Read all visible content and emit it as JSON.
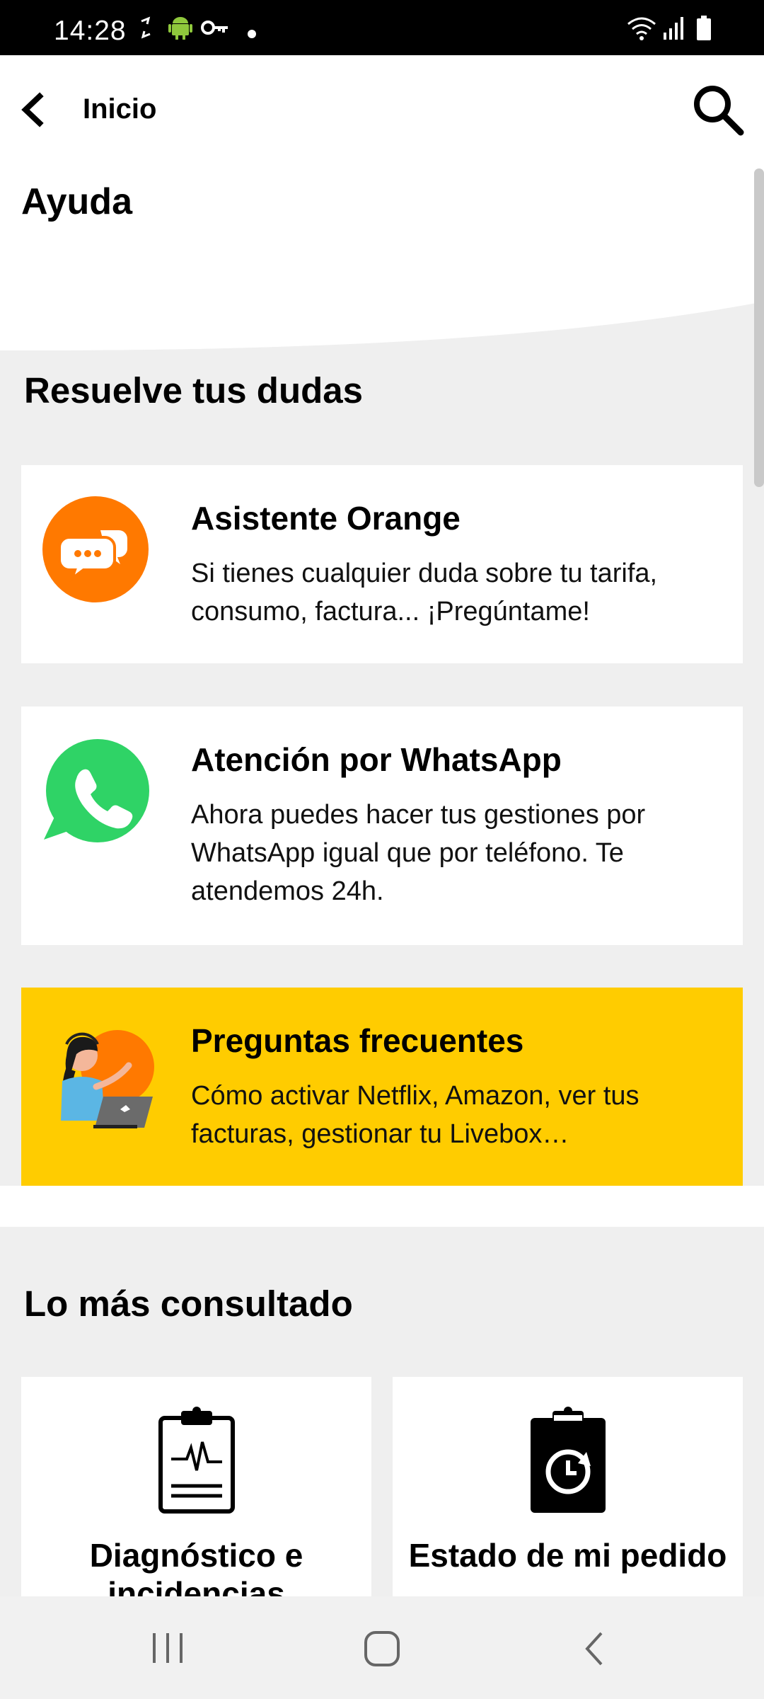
{
  "status_bar": {
    "time": "14:28"
  },
  "header": {
    "back_label": "Inicio",
    "page_title": "Ayuda"
  },
  "section_resuelve": {
    "title": "Resuelve tus dudas",
    "cards": [
      {
        "title": "Asistente Orange",
        "description": "Si tienes cualquier duda sobre tu tarifa, consumo, factura... ¡Pregúntame!",
        "icon": "chat-bubbles-icon",
        "icon_color": "#ff7900"
      },
      {
        "title": "Atención por WhatsApp",
        "description": "Ahora puedes hacer tus gestiones por WhatsApp igual que por teléfono. Te atendemos 24h.",
        "icon": "whatsapp-icon",
        "icon_color": "#2fd366"
      },
      {
        "title": "Preguntas frecuentes",
        "description": "Cómo activar Netflix, Amazon, ver tus facturas, gestionar tu Livebox…",
        "icon": "support-agent-illustration",
        "background": "#ffcc00"
      }
    ]
  },
  "section_consultado": {
    "title": "Lo más consultado",
    "tiles": [
      {
        "label": "Diagnóstico e incidencias",
        "icon": "clipboard-heartbeat-icon"
      },
      {
        "label": "Estado de mi pedido",
        "icon": "clipboard-clock-icon"
      }
    ]
  },
  "colors": {
    "brand_orange": "#ff7900",
    "faq_yellow": "#ffcc00",
    "whatsapp_green": "#2fd366"
  }
}
